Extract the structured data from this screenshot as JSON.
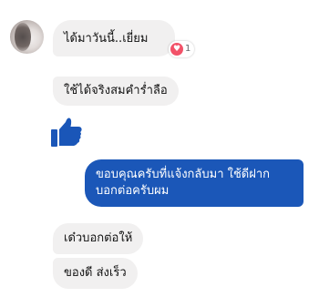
{
  "messages": {
    "received_1": "ได้มาวันนี้..เยี่ยม",
    "received_1_reaction": {
      "icon": "heart-icon",
      "count": "1",
      "color": "#f25268"
    },
    "received_2": "ใช้ได้จริงสมคำร่ำลือ",
    "received_sticker": "thumbs-up-icon",
    "sent_line_1": "ขอบคุณครับที่แจ้งกลับมา ใช้ดีฝาก",
    "sent_line_2": "บอกต่อครับผม",
    "received_3": "เด๋วบอกต่อให้",
    "received_4": "ของดี ส่งเร็ว"
  },
  "colors": {
    "received_bubble": "#f1f0f0",
    "sent_bubble": "#1b57b8",
    "thumbs_up": "#1a56b8"
  }
}
